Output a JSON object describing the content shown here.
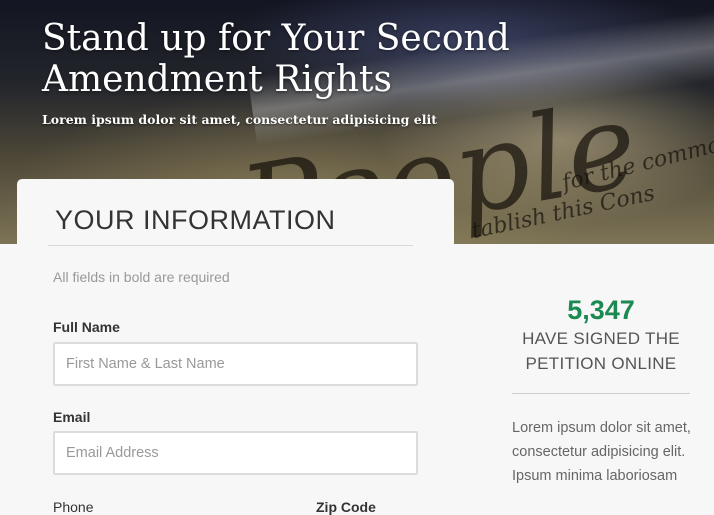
{
  "hero": {
    "title": "Stand up for Your Second Amendment Rights",
    "subtitle": "Lorem ipsum dolor sit amet, consectetur adipisicing elit"
  },
  "form": {
    "title": "YOUR INFORMATION",
    "required_note": "All fields in bold are required",
    "fields": {
      "full_name": {
        "label": "Full Name",
        "placeholder": "First Name & Last Name",
        "value": ""
      },
      "email": {
        "label": "Email",
        "placeholder": "Email Address",
        "value": ""
      },
      "phone": {
        "label": "Phone"
      },
      "zip": {
        "label": "Zip Code"
      }
    }
  },
  "sidebar": {
    "count": "5,347",
    "count_label": "HAVE SIGNED THE PETITION ONLINE",
    "text": "Lorem ipsum dolor sit amet, consectetur adipisicing elit. Ipsum minima laboriosam"
  },
  "colors": {
    "accent_green": "#1a8a52",
    "background": "#f7f7f7"
  }
}
